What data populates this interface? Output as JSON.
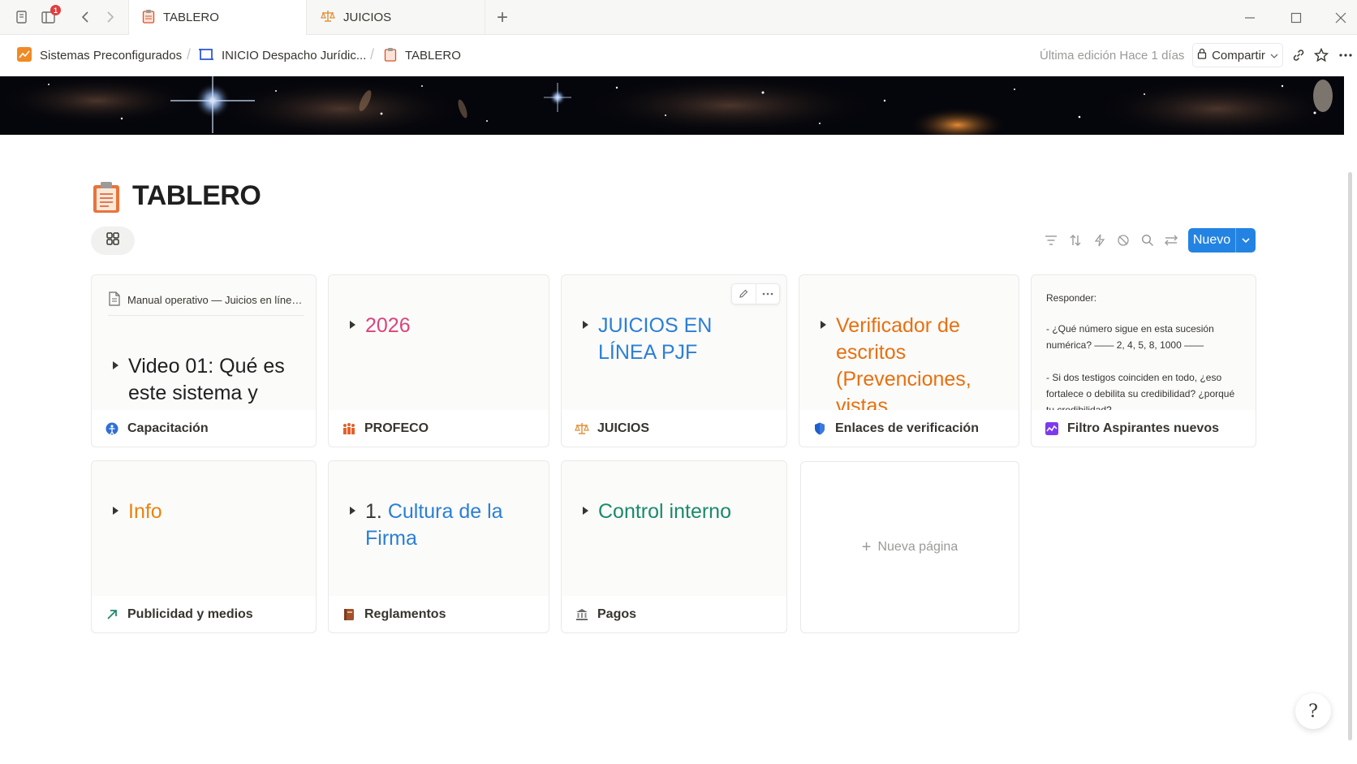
{
  "window": {
    "notification_count": "1",
    "tabs": [
      {
        "label": "TABLERO",
        "icon": "clipboard-icon"
      },
      {
        "label": "JUICIOS",
        "icon": "scales-icon"
      }
    ]
  },
  "breadcrumb": [
    {
      "label": "Sistemas Preconfigurados",
      "icon": "orange-chart-icon"
    },
    {
      "label": "INICIO Despacho Jurídic...",
      "icon": "frame-icon"
    },
    {
      "label": "TABLERO",
      "icon": "clipboard-icon"
    }
  ],
  "topbar": {
    "last_edited": "Última edición Hace 1 días",
    "share_label": "Compartir"
  },
  "page": {
    "title": "TABLERO",
    "new_button_label": "Nuevo"
  },
  "cards": [
    {
      "doc_title": "Manual operativo — Juicios en línea...",
      "preview_text": "Video 01: Qué es este sistema y",
      "preview_color": "#1f1f1f",
      "footer": "Capacitación",
      "footer_icon": "globe-blue-icon"
    },
    {
      "preview_text": "2026",
      "preview_color": "#d9457a",
      "footer": "PROFECO",
      "footer_icon": "people-icon"
    },
    {
      "preview_text": "JUICIOS EN LÍNEA PJF",
      "preview_color": "#2b7fd6",
      "footer": "JUICIOS",
      "footer_icon": "scales-icon"
    },
    {
      "preview_text": "Verificador de escritos (Prevenciones, vistas",
      "preview_color": "#e8700f",
      "footer": "Enlaces de verificación",
      "footer_icon": "shield-icon"
    },
    {
      "preview_heading": "Responder:",
      "preview_lines": [
        "- ¿Qué número sigue en esta sucesión numérica? —— 2, 4, 5, 8, 1000 ——",
        "- Si dos testigos coinciden en todo, ¿eso fortalece o debilita su credibilidad? ¿porqué tu credibilidad?"
      ],
      "footer": "Filtro Aspirantes nuevos",
      "footer_icon": "purple-chart-icon"
    },
    {
      "preview_text": "Info",
      "preview_color": "#e8840f",
      "footer": "Publicidad y medios",
      "footer_icon": "arrow-up-right-icon"
    },
    {
      "preview_prefix": "1.",
      "preview_text": "Cultura de la Firma",
      "preview_color": "#2b7fd6",
      "footer": "Reglamentos",
      "footer_icon": "book-icon"
    },
    {
      "preview_text": "Control interno",
      "preview_color": "#1b8a6b",
      "footer": "Pagos",
      "footer_icon": "bank-icon"
    }
  ],
  "new_page_label": "Nueva página",
  "help_glyph": "?"
}
